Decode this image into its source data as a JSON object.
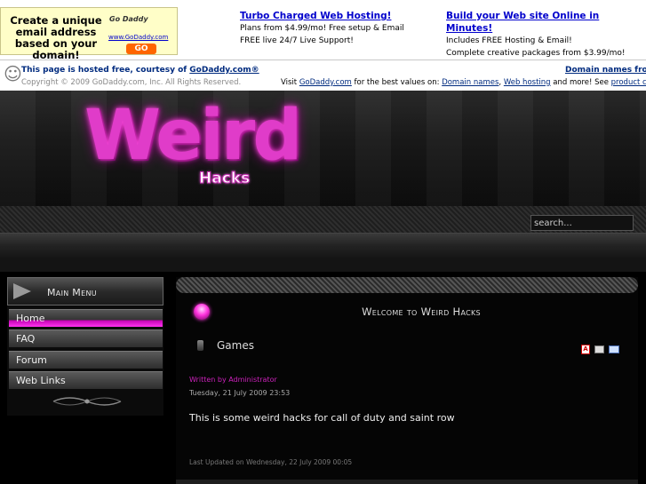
{
  "ad": {
    "box_text": "Create a unique email address based on your domain!",
    "logo": "Go Daddy",
    "url": "www.GoDaddy.com",
    "go": "GO",
    "col1": {
      "title": "Turbo Charged Web Hosting!",
      "line1": "Plans from $4.99/mo! Free setup & Email",
      "line2": "FREE live 24/7 Live Support!"
    },
    "col2": {
      "title": "Build your Web site Online in Minutes!",
      "line1": "Includes FREE Hosting & Email!",
      "line2": "Complete creative packages from $3.99/mo!"
    }
  },
  "hosting": {
    "line1_prefix": "This page is hosted free, courtesy of ",
    "line1_link": "GoDaddy.com®",
    "copyright": "Copyright © 2009 GoDaddy.com, Inc. All Rights Reserved.",
    "right1": "Domain names from",
    "line2_prefix": "Visit ",
    "line2_link1": "GoDaddy.com",
    "line2_mid": " for the best values on: ",
    "line2_link2": "Domain names",
    "line2_sep": ", ",
    "line2_link3": "Web hosting",
    "line2_tail": " and more! See ",
    "line2_link4": "product ca"
  },
  "site": {
    "logo_main": "Weird",
    "logo_sub": "Hacks",
    "search_value": "search..."
  },
  "sidebar": {
    "title": "Main Menu",
    "items": [
      {
        "label": "Home"
      },
      {
        "label": "FAQ"
      },
      {
        "label": "Forum"
      },
      {
        "label": "Web Links"
      }
    ]
  },
  "main": {
    "heading": "Welcome to Weird Hacks",
    "article_title": "Games",
    "written_by": "Written by Administrator",
    "date": "Tuesday, 21 July 2009 23:53",
    "body": "This is some weird hacks for call of duty and saint row",
    "last_updated": "Last Updated on Wednesday, 22 July 2009 00:05"
  }
}
